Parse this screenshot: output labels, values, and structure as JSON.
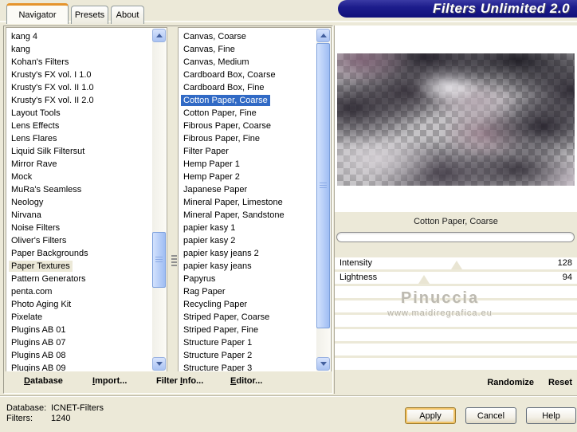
{
  "window": {
    "banner_title": "Filters Unlimited 2.0"
  },
  "tabs": [
    {
      "label": "Navigator",
      "active": true
    },
    {
      "label": "Presets",
      "active": false
    },
    {
      "label": "About",
      "active": false
    }
  ],
  "left_list": {
    "selected": "Paper Textures",
    "items": [
      "kang 4",
      "kang",
      "Kohan's Filters",
      "Krusty's FX vol. I 1.0",
      "Krusty's FX vol. II 1.0",
      "Krusty's FX vol. II 2.0",
      "Layout Tools",
      "Lens Effects",
      "Lens Flares",
      "Liquid Silk Filtersut",
      "Mirror Rave",
      "Mock",
      "MuRa's Seamless",
      "Neology",
      "Nirvana",
      "Noise Filters",
      "Oliver's Filters",
      "Paper Backgrounds",
      "Paper Textures",
      "Pattern Generators",
      "penta.com",
      "Photo Aging Kit",
      "Pixelate",
      "Plugins AB 01",
      "Plugins AB 07",
      "Plugins AB 08",
      "Plugins AB 09"
    ]
  },
  "filter_list": {
    "selected": "Cotton Paper, Coarse",
    "items": [
      "Canvas, Coarse",
      "Canvas, Fine",
      "Canvas, Medium",
      "Cardboard Box, Coarse",
      "Cardboard Box, Fine",
      "Cotton Paper, Coarse",
      "Cotton Paper, Fine",
      "Fibrous Paper, Coarse",
      "Fibrous Paper, Fine",
      "Filter Paper",
      "Hemp Paper 1",
      "Hemp Paper 2",
      "Japanese Paper",
      "Mineral Paper, Limestone",
      "Mineral Paper, Sandstone",
      "papier kasy 1",
      "papier kasy 2",
      "papier kasy jeans 2",
      "papier kasy jeans",
      "Papyrus",
      "Rag Paper",
      "Recycling Paper",
      "Striped Paper, Coarse",
      "Striped Paper, Fine",
      "Structure Paper 1",
      "Structure Paper 2",
      "Structure Paper 3"
    ]
  },
  "preview": {
    "caption": "Cotton Paper, Coarse"
  },
  "sliders": [
    {
      "label": "Intensity",
      "value": 128,
      "max": 255
    },
    {
      "label": "Lightness",
      "value": 94,
      "max": 255
    }
  ],
  "watermark": {
    "line1": "Pinuccia",
    "line2": "www.maidiregrafica.eu"
  },
  "toolbar": {
    "items": [
      {
        "label": "Database",
        "underline": 0
      },
      {
        "label": "Import...",
        "underline": 0
      },
      {
        "label": "Filter Info...",
        "underline": 7
      },
      {
        "label": "Editor...",
        "underline": 0
      }
    ]
  },
  "actions": {
    "randomize": "Randomize",
    "reset": "Reset"
  },
  "status": {
    "database_label": "Database:",
    "database_value": "ICNET-Filters",
    "filters_label": "Filters:",
    "filters_value": "1240"
  },
  "buttons": [
    {
      "label": "Apply",
      "focused": true
    },
    {
      "label": "Cancel",
      "focused": false
    },
    {
      "label": "Help",
      "focused": false
    }
  ],
  "colors": {
    "dialog_bg": "#ece9d8",
    "banner_navy": "#1d1d8c",
    "selection_blue": "#316ac5",
    "tab_accent_orange": "#e5942c"
  }
}
